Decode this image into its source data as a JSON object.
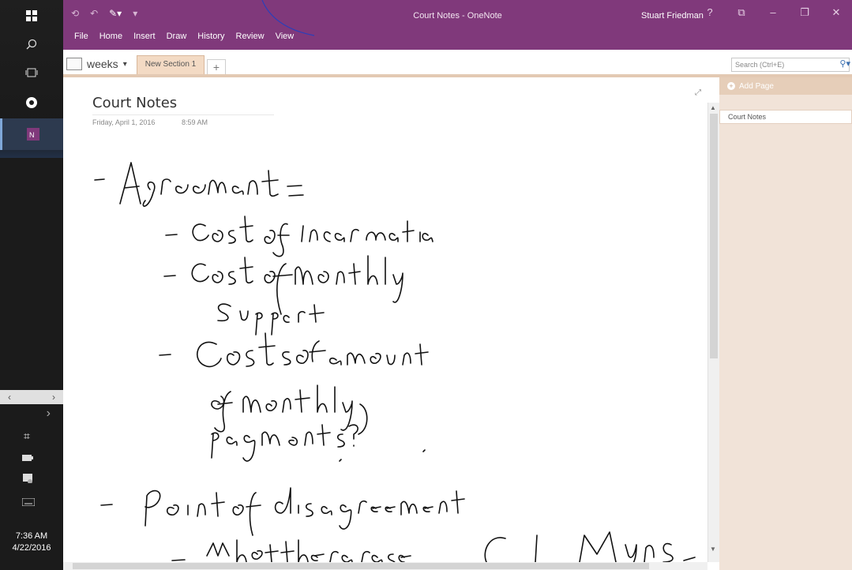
{
  "window": {
    "title": "Court Notes - OneNote",
    "user": "Stuart Friedman",
    "controls": [
      "?",
      "⧉",
      "–",
      "❐",
      "✕"
    ]
  },
  "ribbon": {
    "tabs": [
      "File",
      "Home",
      "Insert",
      "Draw",
      "History",
      "Review",
      "View"
    ]
  },
  "notebook": {
    "name": "weeks",
    "section": "New Section 1",
    "add_section": "+"
  },
  "search": {
    "placeholder": "Search (Ctrl+E)"
  },
  "page": {
    "title": "Court Notes",
    "date": "Friday, April 1, 2016",
    "time": "8:59 AM"
  },
  "pages_pane": {
    "add_page": "Add Page",
    "pages": [
      "Court Notes"
    ]
  },
  "taskbar": {
    "time": "7:36 AM",
    "date": "4/22/2016"
  },
  "colors": {
    "accent": "#80397b",
    "section_tab": "#f3dac4",
    "pages_pane": "#f1e3d8"
  }
}
